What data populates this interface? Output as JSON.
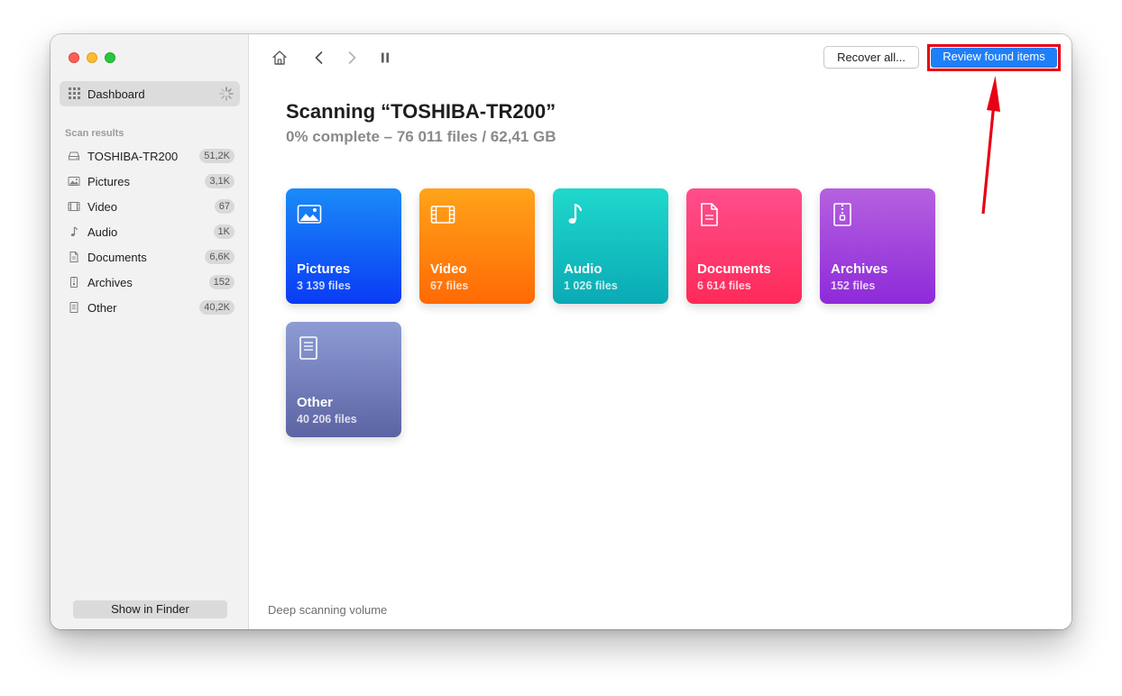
{
  "sidebar": {
    "dashboard_label": "Dashboard",
    "section_title": "Scan results",
    "items": [
      {
        "label": "TOSHIBA-TR200",
        "badge": "51,2K",
        "icon": "drive-icon"
      },
      {
        "label": "Pictures",
        "badge": "3,1K",
        "icon": "image-icon"
      },
      {
        "label": "Video",
        "badge": "67",
        "icon": "film-icon"
      },
      {
        "label": "Audio",
        "badge": "1K",
        "icon": "music-note-icon"
      },
      {
        "label": "Documents",
        "badge": "6,6K",
        "icon": "document-icon"
      },
      {
        "label": "Archives",
        "badge": "152",
        "icon": "archive-icon"
      },
      {
        "label": "Other",
        "badge": "40,2K",
        "icon": "file-icon"
      }
    ],
    "show_in_finder": "Show in Finder"
  },
  "toolbar": {
    "recover_all": "Recover all...",
    "review_found": "Review found items"
  },
  "main": {
    "title": "Scanning “TOSHIBA-TR200”",
    "subtitle": "0% complete – 76 011 files / 62,41 GB",
    "status": "Deep scanning volume",
    "tiles": [
      {
        "name": "Pictures",
        "count": "3 139 files",
        "icon": "image-icon",
        "color_top": "#1a8bf8",
        "color_bottom": "#0a3bf5"
      },
      {
        "name": "Video",
        "count": "67 files",
        "icon": "film-icon",
        "color_top": "#ffa31a",
        "color_bottom": "#ff6a05"
      },
      {
        "name": "Audio",
        "count": "1 026 files",
        "icon": "music-note-icon",
        "color_top": "#1fd8cc",
        "color_bottom": "#0aaab5"
      },
      {
        "name": "Documents",
        "count": "6 614 files",
        "icon": "document-icon",
        "color_top": "#ff4e8c",
        "color_bottom": "#fe2a59"
      },
      {
        "name": "Archives",
        "count": "152 files",
        "icon": "archive-icon",
        "color_top": "#b561df",
        "color_bottom": "#8e2ad9"
      },
      {
        "name": "Other",
        "count": "40 206 files",
        "icon": "file-icon",
        "color_top": "#8d9cd5",
        "color_bottom": "#5c64a3"
      }
    ]
  },
  "annotation": {
    "arrow_color": "#e80014",
    "highlight_color": "#e80014"
  }
}
